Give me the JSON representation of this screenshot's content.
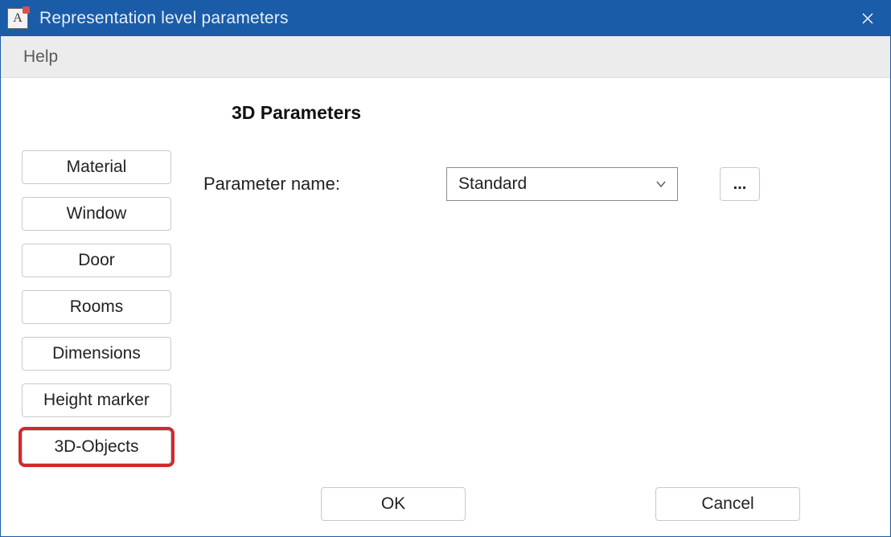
{
  "window": {
    "title": "Representation level parameters"
  },
  "menubar": {
    "help": "Help"
  },
  "sidebar": {
    "items": [
      {
        "label": "Material",
        "highlighted": false
      },
      {
        "label": "Window",
        "highlighted": false
      },
      {
        "label": "Door",
        "highlighted": false
      },
      {
        "label": "Rooms",
        "highlighted": false
      },
      {
        "label": "Dimensions",
        "highlighted": false
      },
      {
        "label": "Height marker",
        "highlighted": false
      },
      {
        "label": "3D-Objects",
        "highlighted": true
      }
    ]
  },
  "main": {
    "section_title": "3D Parameters",
    "param_name_label": "Parameter name:",
    "param_name_value": "Standard",
    "more_label": "..."
  },
  "footer": {
    "ok": "OK",
    "cancel": "Cancel"
  }
}
